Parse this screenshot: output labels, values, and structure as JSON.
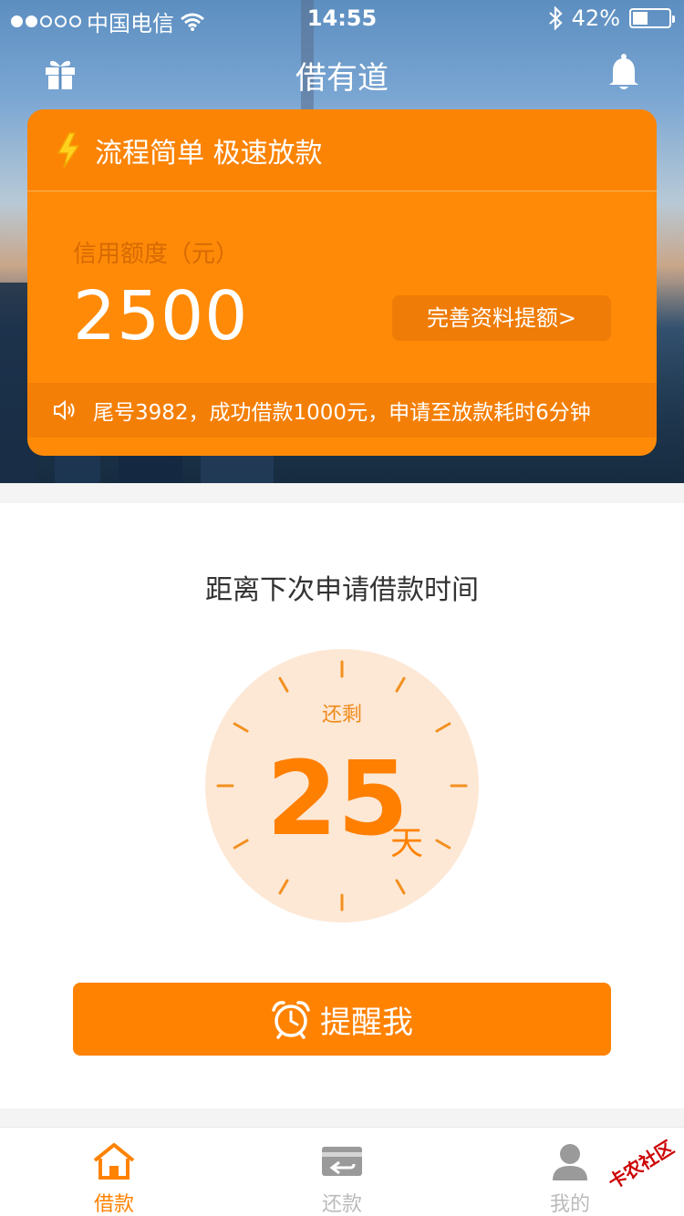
{
  "status": {
    "carrier": "中国电信",
    "time": "14:55",
    "battery_text": "42%",
    "battery_level": 0.42
  },
  "nav": {
    "title": "借有道"
  },
  "card": {
    "slogan": "流程简单 极速放款",
    "credit_label": "信用额度（元）",
    "credit_amount": "2500",
    "improve_label": "完善资料提额>",
    "notice": "尾号3982，成功借款1000元，申请至放款耗时6分钟"
  },
  "countdown": {
    "subtitle": "距离下次申请借款时间",
    "remain_label": "还剩",
    "days": "25",
    "unit": "天"
  },
  "remind": {
    "label": "提醒我"
  },
  "tabs": [
    {
      "label": "借款",
      "icon": "home-icon",
      "active": true
    },
    {
      "label": "还款",
      "icon": "repay-card-icon",
      "active": false
    },
    {
      "label": "我的",
      "icon": "user-icon",
      "active": false
    }
  ],
  "watermark": "卡农社区",
  "colors": {
    "accent": "#ff8200",
    "card": "#ff8a07",
    "clock_bg": "#fde8d6"
  }
}
